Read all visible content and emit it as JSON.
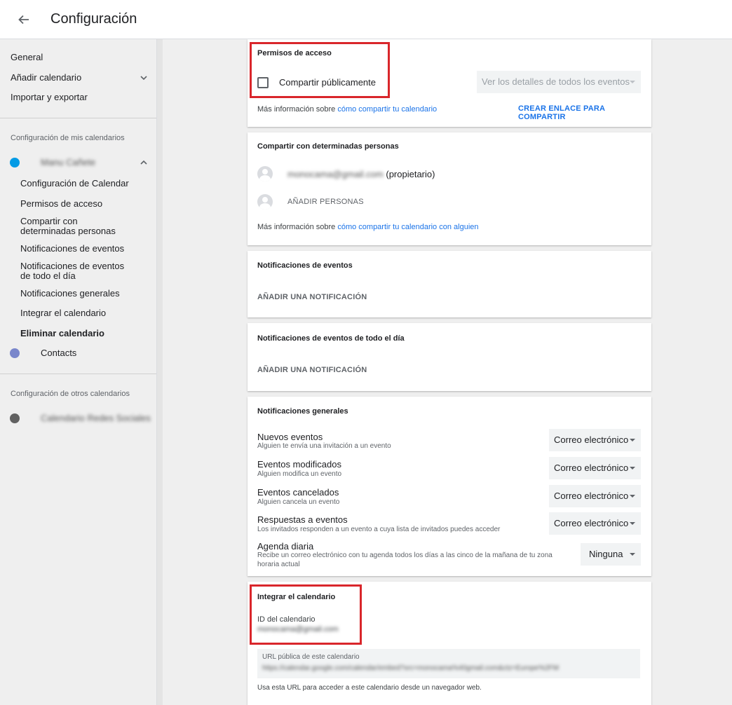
{
  "header": {
    "title": "Configuración"
  },
  "sidebar": {
    "general": "General",
    "add_calendar": "Añadir calendario",
    "import_export": "Importar y exportar",
    "my_calendars_label": "Configuración de mis calendarios",
    "my_calendar_name": "Manu Cañete",
    "sub_items": [
      "Configuración de Calendar",
      "Permisos de acceso",
      "Compartir con determinadas personas",
      "Notificaciones de eventos",
      "Notificaciones de eventos de todo el día",
      "Notificaciones generales",
      "Integrar el calendario",
      "Eliminar calendario"
    ],
    "contacts": "Contacts",
    "other_calendars_label": "Configuración de otros calendarios",
    "other_calendar_name": "Calendario Redes Sociales"
  },
  "colors": {
    "my_calendar_dot": "#039be5",
    "contacts_dot": "#7986cb",
    "other_calendar_dot": "#616161",
    "accent": "#1a73e8",
    "highlight": "#d9262b"
  },
  "access": {
    "title": "Permisos de acceso",
    "share_public_label": "Compartir públicamente",
    "share_public_checked": false,
    "details_select": "Ver los detalles de todos los eventos",
    "more_info_prefix": "Más información sobre ",
    "more_info_link": "cómo compartir tu calendario",
    "create_link": "CREAR ENLACE PARA COMPARTIR"
  },
  "share_people": {
    "title": "Compartir con determinadas personas",
    "owner_email": "monocama@gmail.com",
    "owner_role": "(propietario)",
    "add_people": "AÑADIR PERSONAS",
    "more_info_prefix": "Más información sobre ",
    "more_info_link": "cómo compartir tu calendario con alguien"
  },
  "event_notifications": {
    "title": "Notificaciones de eventos",
    "add": "AÑADIR UNA NOTIFICACIÓN"
  },
  "allday_notifications": {
    "title": "Notificaciones de eventos de todo el día",
    "add": "AÑADIR UNA NOTIFICACIÓN"
  },
  "general_notifications": {
    "title": "Notificaciones generales",
    "rows": [
      {
        "title": "Nuevos eventos",
        "desc": "Alguien te envía una invitación a un evento",
        "value": "Correo electrónico"
      },
      {
        "title": "Eventos modificados",
        "desc": "Alguien modifica un evento",
        "value": "Correo electrónico"
      },
      {
        "title": "Eventos cancelados",
        "desc": "Alguien cancela un evento",
        "value": "Correo electrónico"
      },
      {
        "title": "Respuestas a eventos",
        "desc": "Los invitados responden a un evento a cuya lista de invitados puedes acceder",
        "value": "Correo electrónico"
      },
      {
        "title": "Agenda diaria",
        "desc": "Recibe un correo electrónico con tu agenda todos los días a las cinco de la mañana de tu zona horaria actual",
        "value": "Ninguna"
      }
    ]
  },
  "integrate": {
    "title": "Integrar el calendario",
    "id_label": "ID del calendario",
    "id_value": "monocama@gmail.com",
    "url_label": "URL pública de este calendario",
    "url_value": "https://calendar.google.com/calendar/embed?src=monocama%40gmail.com&ctz=Europe%2FM",
    "url_help": "Usa esta URL para acceder a este calendario desde un navegador web."
  }
}
